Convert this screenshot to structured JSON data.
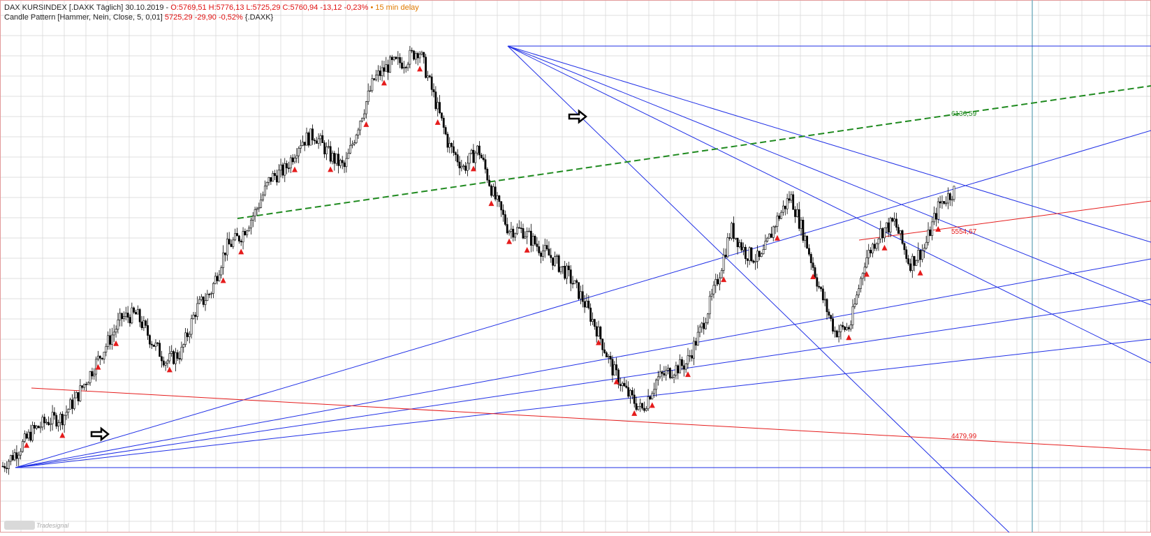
{
  "header": {
    "symbol": "DAX KURSINDEX [.DAXK Täglich] 30.10.2019 - ",
    "ohlc": "O:5769,51 H:5776,13 L:5725,29 C:5760,94 -13,12 -0,23%",
    "delay": "• 15 min delay",
    "indicator": "Candle Pattern [Hammer, Nein, Close, 5, 0,01] ",
    "indicator_values": "5725,29 -29,90 -0,52%",
    "indicator_symbol": " {.DAXK}"
  },
  "watermark": "Tradesignal",
  "colors": {
    "grid": "#d4d4d4",
    "blue": "#1f2fe6",
    "red": "#e51c1c",
    "green": "#1f8a1f",
    "candle": "#000000",
    "cyan": "#7fb3c4",
    "marker": "#e51c1c",
    "border": "#e29a9a"
  },
  "chart_data": {
    "type": "candlestick",
    "title": "DAX KURSINDEX [.DAXK Täglich]",
    "last": {
      "open": 5769.51,
      "high": 5776.13,
      "low": 5725.29,
      "close": 5760.94,
      "change": -13.12,
      "change_pct": -0.23
    },
    "level_labels": [
      {
        "text": "6136,59",
        "color": "green"
      },
      {
        "text": "5554,67",
        "color": "red"
      },
      {
        "text": "4479,99",
        "color": "red"
      }
    ],
    "approx_price_path": [
      4300,
      4390,
      4500,
      4560,
      4580,
      4700,
      4850,
      5000,
      5150,
      5170,
      5020,
      4900,
      4950,
      5200,
      5300,
      5550,
      5620,
      5760,
      5950,
      6000,
      6160,
      6200,
      6080,
      6010,
      6280,
      6520,
      6600,
      6620,
      6690,
      6420,
      6140,
      6010,
      6120,
      5860,
      5660,
      5650,
      5560,
      5490,
      5400,
      5260,
      5080,
      4860,
      4720,
      4620,
      4800,
      4850,
      4890,
      5090,
      5340,
      5660,
      5520,
      5480,
      5700,
      5850,
      5600,
      5300,
      5070,
      5100,
      5480,
      5640,
      5700,
      5460,
      5550,
      5800,
      5880
    ],
    "grid": true
  }
}
